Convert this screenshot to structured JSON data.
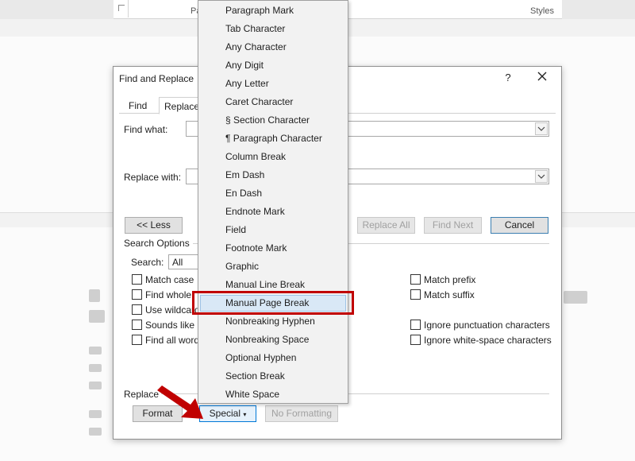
{
  "ribbon": {
    "group_paragraph": "Pa",
    "group_styles": "Styles"
  },
  "dialog": {
    "title": "Find and Replace",
    "help": "?",
    "tabs": [
      {
        "label": "Find"
      },
      {
        "label": "Replace"
      }
    ],
    "find_what_label": "Find what:",
    "replace_with_label": "Replace with:",
    "less_button": "<< Less",
    "replace_all_button": "Replace All",
    "find_next_button": "Find Next",
    "cancel_button": "Cancel",
    "search_options_label": "Search Options",
    "search_label": "Search:",
    "search_value": "All",
    "options_left": [
      {
        "label": "Match case"
      },
      {
        "label": "Find whole"
      },
      {
        "label": "Use wildcard"
      },
      {
        "label": "Sounds like ("
      },
      {
        "label": "Find all word"
      }
    ],
    "options_right": [
      {
        "label": "Match prefix"
      },
      {
        "label": "Match suffix"
      },
      {
        "label": "Ignore punctuation characters"
      },
      {
        "label": "Ignore white-space characters"
      }
    ],
    "replace_section_label": "Replace",
    "format_button": "Format",
    "special_button": "Special",
    "no_formatting_button": "No Formatting"
  },
  "special_menu": {
    "items": [
      "Paragraph Mark",
      "Tab Character",
      "Any Character",
      "Any Digit",
      "Any Letter",
      "Caret Character",
      "§ Section Character",
      "¶ Paragraph Character",
      "Column Break",
      "Em Dash",
      "En Dash",
      "Endnote Mark",
      "Field",
      "Footnote Mark",
      "Graphic",
      "Manual Line Break",
      "Manual Page Break",
      "Nonbreaking Hyphen",
      "Nonbreaking Space",
      "Optional Hyphen",
      "Section Break",
      "White Space"
    ],
    "highlighted": "Manual Page Break"
  },
  "colors": {
    "highlight_box": "#c00000",
    "arrow": "#c00000",
    "hover": "#d9e8f6"
  }
}
